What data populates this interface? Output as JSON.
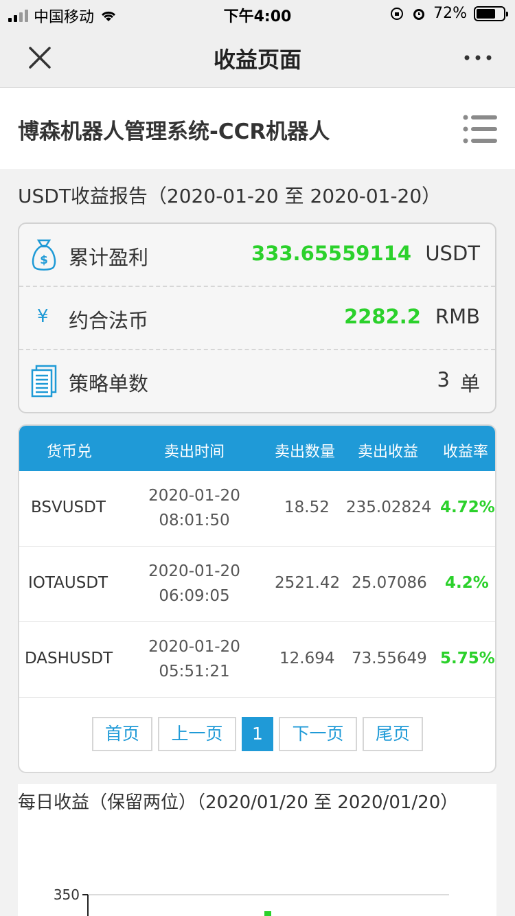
{
  "status_bar": {
    "carrier": "中国移动",
    "time": "下午4:00",
    "battery": "72%",
    "battery_level": 0.72
  },
  "nav": {
    "title": "收益页面",
    "close_icon": "close-icon",
    "more_icon": "more-icon"
  },
  "app": {
    "title": "博森机器人管理系统-CCR机器人",
    "menu_icon": "menu-icon"
  },
  "report": {
    "title": "USDT收益报告（2020-01-20 至 2020-01-20）"
  },
  "summary": {
    "profit_label": "累计盈利",
    "profit_value": "333.65559114",
    "profit_unit": "USDT",
    "fiat_symbol": "¥",
    "fiat_label": "约合法币",
    "fiat_value": "2282.2",
    "fiat_unit": "RMB",
    "orders_label": "策略单数",
    "orders_value": "3",
    "orders_unit": "单",
    "accent": "#1e9ad6",
    "positive": "#2bd12b"
  },
  "table": {
    "headers": [
      "货币兑",
      "卖出时间",
      "卖出数量",
      "卖出收益",
      "收益率"
    ],
    "rows": [
      {
        "pair": "BSVUSDT",
        "date": "2020-01-20",
        "time": "08:01:50",
        "qty": "18.52",
        "profit": "235.02824",
        "rate": "4.72%"
      },
      {
        "pair": "IOTAUSDT",
        "date": "2020-01-20",
        "time": "06:09:05",
        "qty": "2521.42",
        "profit": "25.07086",
        "rate": "4.2%"
      },
      {
        "pair": "DASHUSDT",
        "date": "2020-01-20",
        "time": "05:51:21",
        "qty": "12.694",
        "profit": "73.55649",
        "rate": "5.75%"
      }
    ],
    "header_color": "#1f9ad7"
  },
  "pager": {
    "first": "首页",
    "prev": "上一页",
    "current": "1",
    "next": "下一页",
    "last": "尾页"
  },
  "daily": {
    "title": "每日收益（保留两位）（2020/01/20 至 2020/01/20）"
  },
  "chart_data": {
    "type": "bar",
    "title": "每日收益（保留两位）（2020/01/20 至 2020/01/20）",
    "y_tick_labels": [
      "350"
    ],
    "ylim_top": 350,
    "color": "#2bd12b"
  }
}
